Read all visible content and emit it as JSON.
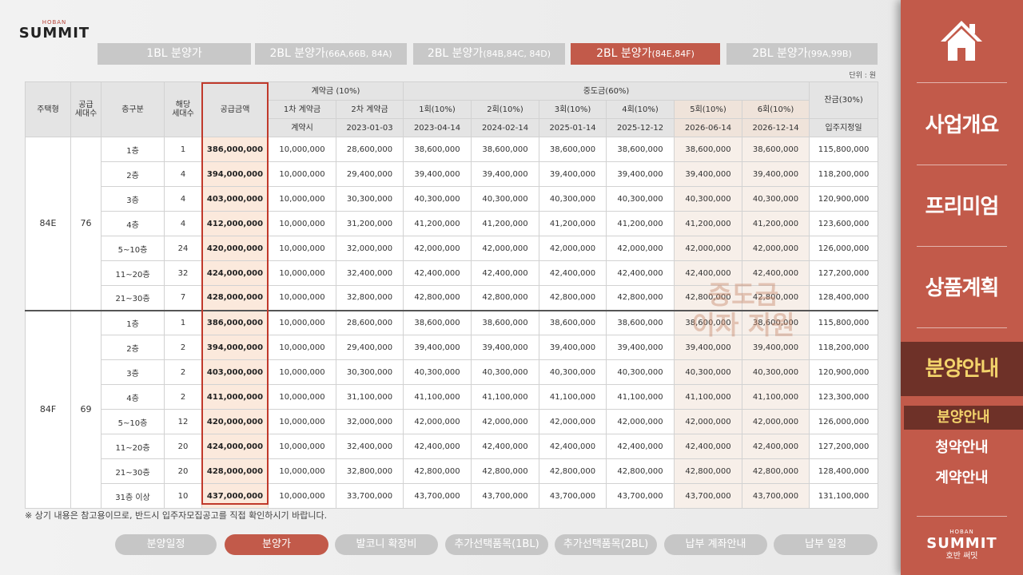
{
  "brand": {
    "small": "HOBAN",
    "name": "SUMMIT"
  },
  "block_tabs": [
    {
      "main": "1BL 분양가",
      "sub": ""
    },
    {
      "main": "2BL 분양가",
      "sub": "(66A,66B, 84A)"
    },
    {
      "main": "2BL 분양가",
      "sub": "(84B,84C, 84D)"
    },
    {
      "main": "2BL 분양가",
      "sub": "(84E,84F)"
    },
    {
      "main": "2BL 분양가",
      "sub": "(99A,99B)"
    }
  ],
  "unit_label": "단위 : 원",
  "table": {
    "headers": {
      "house_type": "주택형",
      "supply_units": "공급\n세대수",
      "floor": "층구분",
      "units": "해당\n세대수",
      "supply_amount": "공급금액",
      "contract_group": "계약금 (10%)",
      "middle_group": "중도금(60%)",
      "balance_group": "잔금(30%)",
      "contract_cols": [
        "1차 계약금",
        "2차 계약금"
      ],
      "contract_dates": [
        "계약시",
        "2023-01-03"
      ],
      "middle_cols": [
        "1회(10%)",
        "2회(10%)",
        "3회(10%)",
        "4회(10%)",
        "5회(10%)",
        "6회(10%)"
      ],
      "middle_dates": [
        "2023-04-14",
        "2024-02-14",
        "2025-01-14",
        "2025-12-12",
        "2026-06-14",
        "2026-12-14"
      ],
      "balance_date": "입주지정일"
    },
    "groups": [
      {
        "type": "84E",
        "supply": "76",
        "rows": [
          {
            "floor": "1층",
            "units": "1",
            "amount": "386,000,000",
            "c1": "10,000,000",
            "c2": "28,600,000",
            "m": [
              "38,600,000",
              "38,600,000",
              "38,600,000",
              "38,600,000",
              "38,600,000",
              "38,600,000"
            ],
            "bal": "115,800,000"
          },
          {
            "floor": "2층",
            "units": "4",
            "amount": "394,000,000",
            "c1": "10,000,000",
            "c2": "29,400,000",
            "m": [
              "39,400,000",
              "39,400,000",
              "39,400,000",
              "39,400,000",
              "39,400,000",
              "39,400,000"
            ],
            "bal": "118,200,000"
          },
          {
            "floor": "3층",
            "units": "4",
            "amount": "403,000,000",
            "c1": "10,000,000",
            "c2": "30,300,000",
            "m": [
              "40,300,000",
              "40,300,000",
              "40,300,000",
              "40,300,000",
              "40,300,000",
              "40,300,000"
            ],
            "bal": "120,900,000"
          },
          {
            "floor": "4층",
            "units": "4",
            "amount": "412,000,000",
            "c1": "10,000,000",
            "c2": "31,200,000",
            "m": [
              "41,200,000",
              "41,200,000",
              "41,200,000",
              "41,200,000",
              "41,200,000",
              "41,200,000"
            ],
            "bal": "123,600,000"
          },
          {
            "floor": "5~10층",
            "units": "24",
            "amount": "420,000,000",
            "c1": "10,000,000",
            "c2": "32,000,000",
            "m": [
              "42,000,000",
              "42,000,000",
              "42,000,000",
              "42,000,000",
              "42,000,000",
              "42,000,000"
            ],
            "bal": "126,000,000"
          },
          {
            "floor": "11~20층",
            "units": "32",
            "amount": "424,000,000",
            "c1": "10,000,000",
            "c2": "32,400,000",
            "m": [
              "42,400,000",
              "42,400,000",
              "42,400,000",
              "42,400,000",
              "42,400,000",
              "42,400,000"
            ],
            "bal": "127,200,000"
          },
          {
            "floor": "21~30층",
            "units": "7",
            "amount": "428,000,000",
            "c1": "10,000,000",
            "c2": "32,800,000",
            "m": [
              "42,800,000",
              "42,800,000",
              "42,800,000",
              "42,800,000",
              "42,800,000",
              "42,800,000"
            ],
            "bal": "128,400,000"
          }
        ]
      },
      {
        "type": "84F",
        "supply": "69",
        "rows": [
          {
            "floor": "1층",
            "units": "1",
            "amount": "386,000,000",
            "c1": "10,000,000",
            "c2": "28,600,000",
            "m": [
              "38,600,000",
              "38,600,000",
              "38,600,000",
              "38,600,000",
              "38,600,000",
              "38,600,000"
            ],
            "bal": "115,800,000"
          },
          {
            "floor": "2층",
            "units": "2",
            "amount": "394,000,000",
            "c1": "10,000,000",
            "c2": "29,400,000",
            "m": [
              "39,400,000",
              "39,400,000",
              "39,400,000",
              "39,400,000",
              "39,400,000",
              "39,400,000"
            ],
            "bal": "118,200,000"
          },
          {
            "floor": "3층",
            "units": "2",
            "amount": "403,000,000",
            "c1": "10,000,000",
            "c2": "30,300,000",
            "m": [
              "40,300,000",
              "40,300,000",
              "40,300,000",
              "40,300,000",
              "40,300,000",
              "40,300,000"
            ],
            "bal": "120,900,000"
          },
          {
            "floor": "4층",
            "units": "2",
            "amount": "411,000,000",
            "c1": "10,000,000",
            "c2": "31,100,000",
            "m": [
              "41,100,000",
              "41,100,000",
              "41,100,000",
              "41,100,000",
              "41,100,000",
              "41,100,000"
            ],
            "bal": "123,300,000"
          },
          {
            "floor": "5~10층",
            "units": "12",
            "amount": "420,000,000",
            "c1": "10,000,000",
            "c2": "32,000,000",
            "m": [
              "42,000,000",
              "42,000,000",
              "42,000,000",
              "42,000,000",
              "42,000,000",
              "42,000,000"
            ],
            "bal": "126,000,000"
          },
          {
            "floor": "11~20층",
            "units": "20",
            "amount": "424,000,000",
            "c1": "10,000,000",
            "c2": "32,400,000",
            "m": [
              "42,400,000",
              "42,400,000",
              "42,400,000",
              "42,400,000",
              "42,400,000",
              "42,400,000"
            ],
            "bal": "127,200,000"
          },
          {
            "floor": "21~30층",
            "units": "20",
            "amount": "428,000,000",
            "c1": "10,000,000",
            "c2": "32,800,000",
            "m": [
              "42,800,000",
              "42,800,000",
              "42,800,000",
              "42,800,000",
              "42,800,000",
              "42,800,000"
            ],
            "bal": "128,400,000"
          },
          {
            "floor": "31층 이상",
            "units": "10",
            "amount": "437,000,000",
            "c1": "10,000,000",
            "c2": "33,700,000",
            "m": [
              "43,700,000",
              "43,700,000",
              "43,700,000",
              "43,700,000",
              "43,700,000",
              "43,700,000"
            ],
            "bal": "131,100,000"
          }
        ]
      }
    ]
  },
  "watermark": [
    "중도금",
    "이자 지원"
  ],
  "note": "※ 상기 내용은 참고용이므로, 반드시 입주자모집공고를 직접 확인하시기 바랍니다.",
  "bottom_tabs": [
    "분양일정",
    "분양가",
    "발코니 확장비",
    "추가선택품목(1BL)",
    "추가선택품목(2BL)",
    "납부 계좌안내",
    "납부 일정"
  ],
  "side_nav": {
    "home_icon": "home-icon",
    "menu": [
      "사업개요",
      "프리미엄",
      "상품계획",
      "분양안내"
    ],
    "sub": [
      "분양안내",
      "청약안내",
      "계약안내"
    ],
    "logo": {
      "small": "HOBAN",
      "name": "SUMMIT",
      "kor": "호반 써밋"
    }
  },
  "colors": {
    "accent": "#c25a4a",
    "active_dark": "#6e3128",
    "highlight_text": "#f3d36b",
    "red_box": "#c0392b"
  }
}
